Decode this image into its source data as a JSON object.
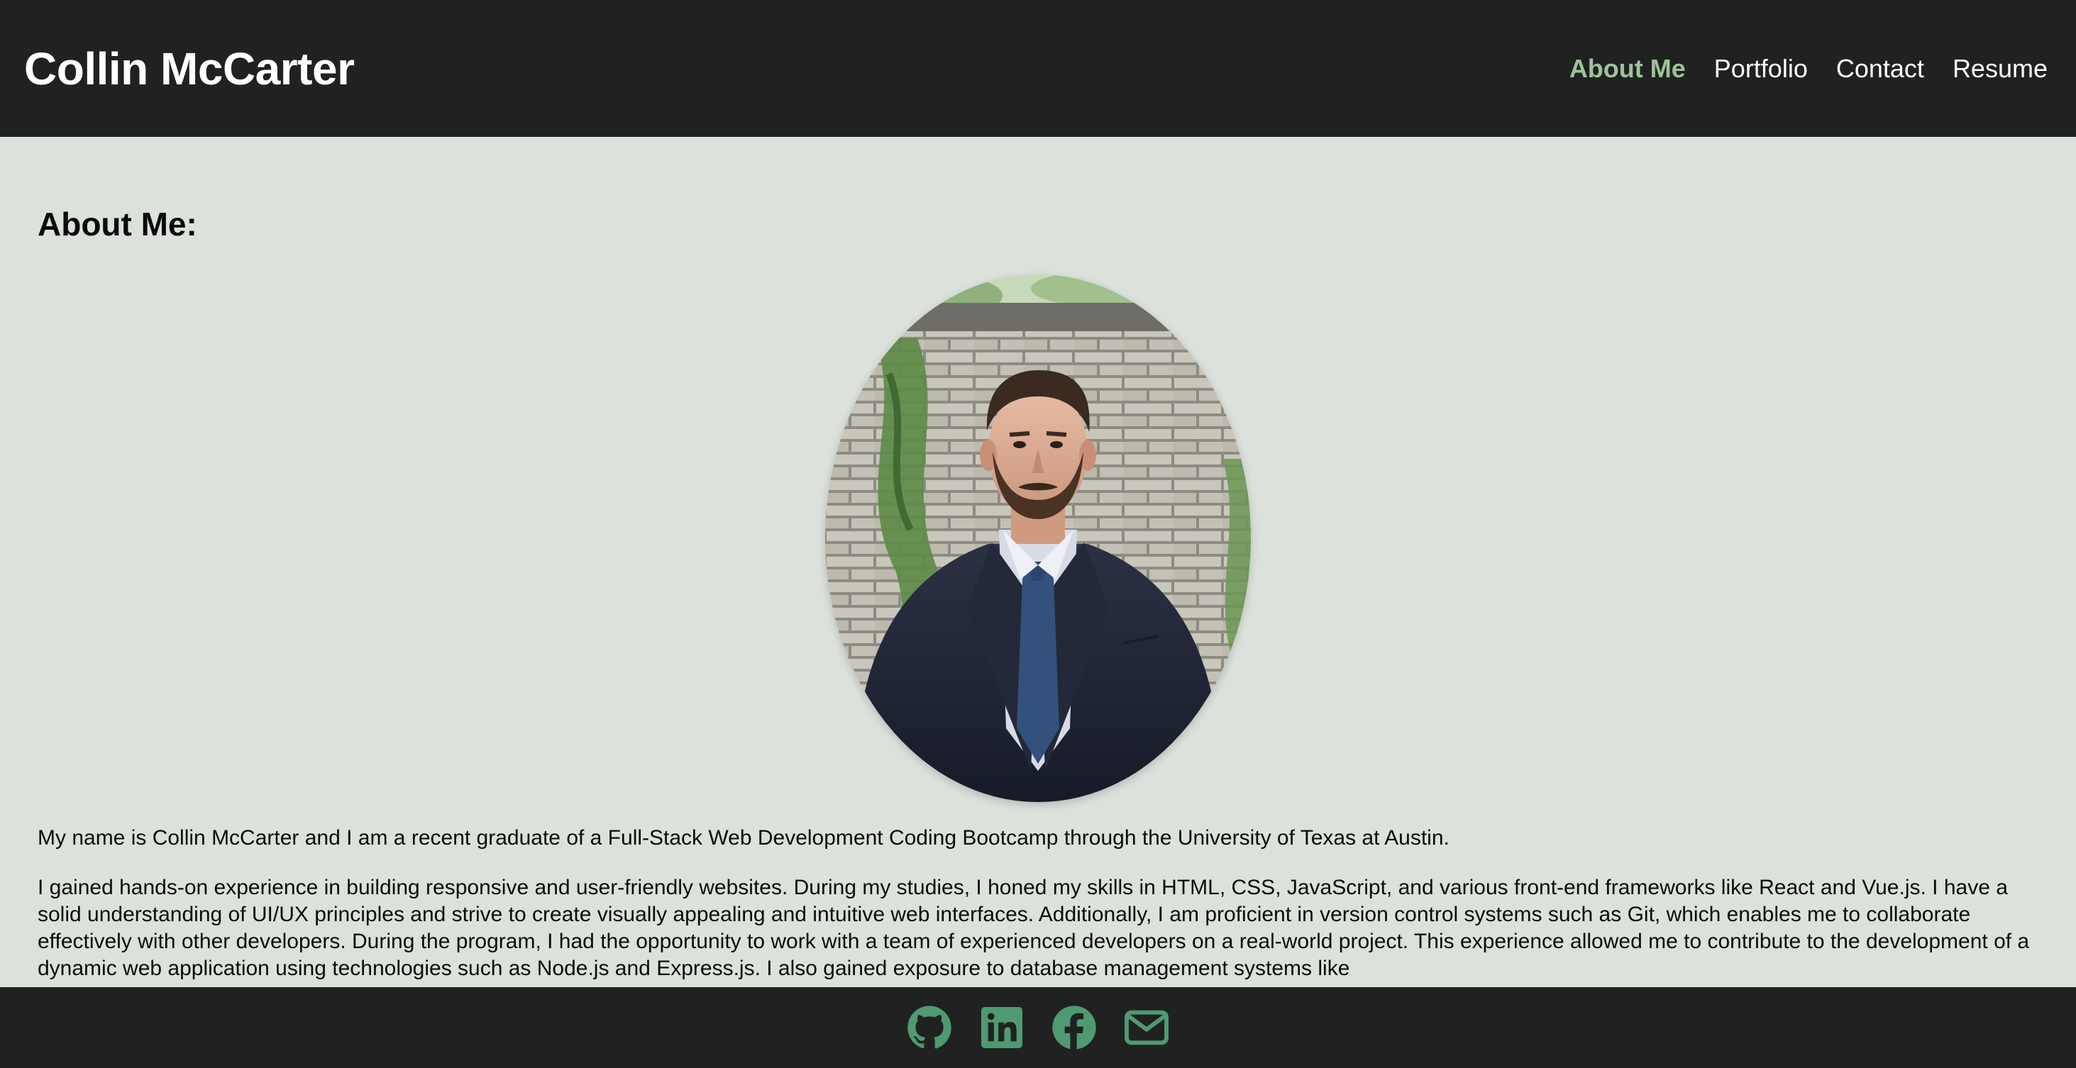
{
  "header": {
    "title": "Collin McCarter",
    "nav": [
      {
        "label": "About Me",
        "active": true
      },
      {
        "label": "Portfolio",
        "active": false
      },
      {
        "label": "Contact",
        "active": false
      },
      {
        "label": "Resume",
        "active": false
      }
    ]
  },
  "main": {
    "section_title": "About Me:",
    "photo_icon": "portrait-photo",
    "paragraphs": [
      "My name is Collin McCarter and I am a recent graduate of a Full-Stack Web Development Coding Bootcamp through the University of Texas at Austin.",
      "I gained hands-on experience in building responsive and user-friendly websites. During my studies, I honed my skills in HTML, CSS, JavaScript, and various front-end frameworks like React and Vue.js. I have a solid understanding of UI/UX principles and strive to create visually appealing and intuitive web interfaces. Additionally, I am proficient in version control systems such as Git, which enables me to collaborate effectively with other developers. During the program, I had the opportunity to work with a team of experienced developers on a real-world project. This experience allowed me to contribute to the development of a dynamic web application using technologies such as Node.js and Express.js. I also gained exposure to database management systems like"
    ]
  },
  "footer": {
    "icons": [
      "github-icon",
      "linkedin-icon",
      "facebook-icon",
      "email-icon"
    ]
  },
  "colors": {
    "header_bg": "#202221",
    "page_bg": "#dce1dc",
    "accent": "#9fc29c",
    "social_icon": "#4f9a72"
  }
}
